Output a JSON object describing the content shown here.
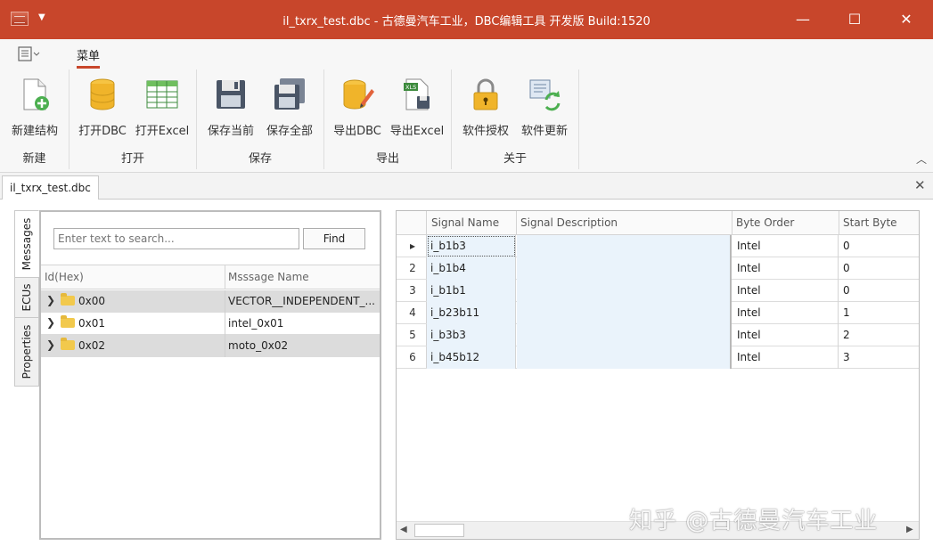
{
  "window": {
    "title": "il_txrx_test.dbc - 古德曼汽车工业，DBC编辑工具 开发版  Build:1520",
    "controls": {
      "minimize": "—",
      "maximize": "☐",
      "close": "✕"
    }
  },
  "ribbon": {
    "tab_label": "菜单",
    "groups": [
      {
        "label": "新建",
        "buttons": [
          {
            "label": "新建结构",
            "icon": "new-structure-icon"
          }
        ]
      },
      {
        "label": "打开",
        "buttons": [
          {
            "label": "打开DBC",
            "icon": "database-icon"
          },
          {
            "label": "打开Excel",
            "icon": "spreadsheet-icon"
          }
        ]
      },
      {
        "label": "保存",
        "buttons": [
          {
            "label": "保存当前",
            "icon": "floppy-icon"
          },
          {
            "label": "保存全部",
            "icon": "floppy-all-icon"
          }
        ]
      },
      {
        "label": "导出",
        "buttons": [
          {
            "label": "导出DBC",
            "icon": "export-db-icon"
          },
          {
            "label": "导出Excel",
            "icon": "export-xls-icon"
          }
        ]
      },
      {
        "label": "关于",
        "buttons": [
          {
            "label": "软件授权",
            "icon": "lock-icon"
          },
          {
            "label": "软件更新",
            "icon": "update-icon"
          }
        ]
      }
    ]
  },
  "document": {
    "tab": "il_txrx_test.dbc"
  },
  "side_tabs": [
    "Messages",
    "ECUs",
    "Properties"
  ],
  "messages": {
    "search_placeholder": "Enter text to search...",
    "find_label": "Find",
    "columns": [
      "Id(Hex)",
      "Msssage Name"
    ],
    "rows": [
      {
        "id": "0x00",
        "name": "VECTOR__INDEPENDENT_..."
      },
      {
        "id": "0x01",
        "name": "intel_0x01"
      },
      {
        "id": "0x02",
        "name": "moto_0x02"
      }
    ]
  },
  "signals": {
    "columns": [
      "Signal Name",
      "Signal Description",
      "Byte Order",
      "Start Byte"
    ],
    "rows": [
      {
        "num": "",
        "name": "i_b1b3",
        "desc": "",
        "order": "Intel",
        "start": "0"
      },
      {
        "num": "2",
        "name": "i_b1b4",
        "desc": "",
        "order": "Intel",
        "start": "0"
      },
      {
        "num": "3",
        "name": "i_b1b1",
        "desc": "",
        "order": "Intel",
        "start": "0"
      },
      {
        "num": "4",
        "name": "i_b23b11",
        "desc": "",
        "order": "Intel",
        "start": "1"
      },
      {
        "num": "5",
        "name": "i_b3b3",
        "desc": "",
        "order": "Intel",
        "start": "2"
      },
      {
        "num": "6",
        "name": "i_b45b12",
        "desc": "",
        "order": "Intel",
        "start": "3"
      }
    ]
  },
  "watermark": "知乎 @古德曼汽车工业",
  "colors": {
    "accent": "#c8462b",
    "row_alt": "#dcdcdc",
    "selection": "#eaf3fb"
  }
}
